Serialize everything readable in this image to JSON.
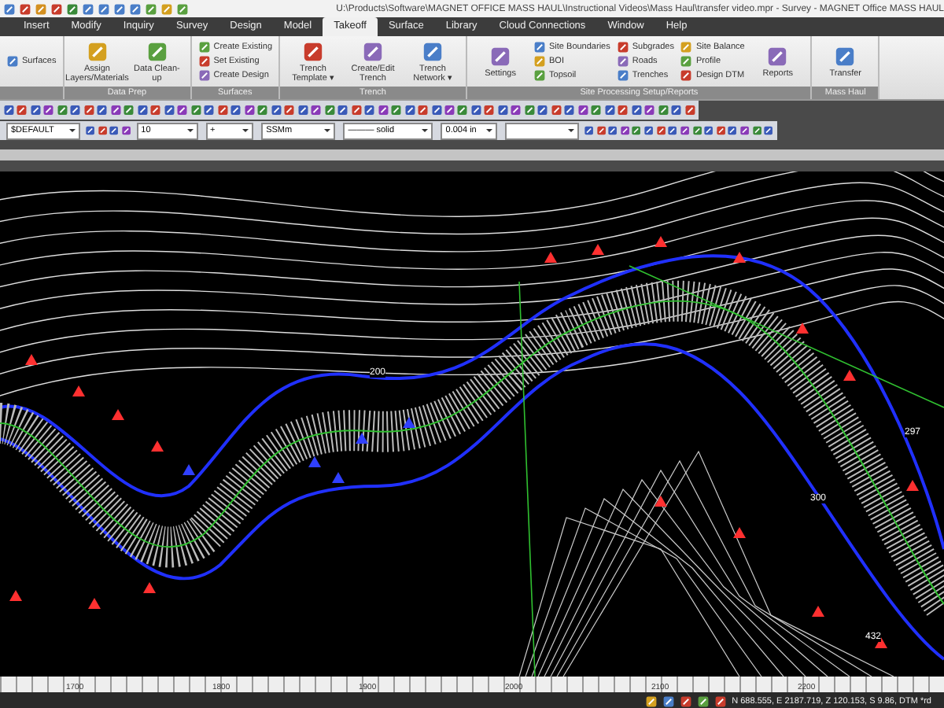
{
  "window": {
    "title": "U:\\Products\\Software\\MAGNET OFFICE MASS HAUL\\Instructional Videos\\Mass Haul\\transfer video.mpr - Survey - MAGNET Office MASS HAUL"
  },
  "tabs": [
    {
      "label": "Insert",
      "selected": false
    },
    {
      "label": "Modify",
      "selected": false
    },
    {
      "label": "Inquiry",
      "selected": false
    },
    {
      "label": "Survey",
      "selected": false
    },
    {
      "label": "Design",
      "selected": false
    },
    {
      "label": "Model",
      "selected": false
    },
    {
      "label": "Takeoff",
      "selected": true
    },
    {
      "label": "Surface",
      "selected": false
    },
    {
      "label": "Library",
      "selected": false
    },
    {
      "label": "Cloud Connections",
      "selected": false
    },
    {
      "label": "Window",
      "selected": false
    },
    {
      "label": "Help",
      "selected": false
    }
  ],
  "ribbon_groups": [
    {
      "items": [
        {
          "kind": "small",
          "label": "Surfaces"
        }
      ]
    },
    {
      "label": "Data Prep",
      "items": [
        {
          "kind": "large",
          "label": "Assign Layers/Materials"
        },
        {
          "kind": "large",
          "label": "Data Clean-up"
        }
      ]
    },
    {
      "label": "Surfaces",
      "items": [
        {
          "kind": "small",
          "label": "Create Existing"
        },
        {
          "kind": "small",
          "label": "Set Existing"
        },
        {
          "kind": "small",
          "label": "Create Design"
        }
      ]
    },
    {
      "label": "Trench",
      "items": [
        {
          "kind": "large",
          "label": "Trench Template ▾"
        },
        {
          "kind": "large",
          "label": "Create/Edit Trench"
        },
        {
          "kind": "large",
          "label": "Trench Network ▾"
        }
      ]
    },
    {
      "label": "Site Processing Setup/Reports",
      "items": [
        {
          "kind": "large",
          "label": "Settings"
        },
        {
          "kind": "small",
          "label": "Site Boundaries"
        },
        {
          "kind": "small",
          "label": "BOI"
        },
        {
          "kind": "small",
          "label": "Topsoil"
        },
        {
          "kind": "small",
          "label": "Subgrades"
        },
        {
          "kind": "small",
          "label": "Roads"
        },
        {
          "kind": "small",
          "label": "Trenches"
        },
        {
          "kind": "small",
          "label": "Site Balance"
        },
        {
          "kind": "small",
          "label": "Profile"
        },
        {
          "kind": "small",
          "label": "Design DTM"
        },
        {
          "kind": "large",
          "label": "Reports"
        }
      ]
    },
    {
      "label": "Mass Haul",
      "items": [
        {
          "kind": "large",
          "label": "Transfer"
        }
      ]
    }
  ],
  "dropdowns": [
    {
      "value": "$DEFAULT"
    },
    {
      "value": "10"
    },
    {
      "value": "+"
    },
    {
      "value": "SSMm"
    },
    {
      "value": "——— solid"
    },
    {
      "value": "0.004 in"
    }
  ],
  "canvas_labels": [
    "200",
    "300",
    "297",
    "432"
  ],
  "ruler": [
    "1700",
    "1800",
    "1900",
    "2000",
    "2100",
    "2200"
  ],
  "status": {
    "readout": "N 688.555,  E 2187.719,  Z 120.153,  S 9.86,  DTM *rd"
  }
}
